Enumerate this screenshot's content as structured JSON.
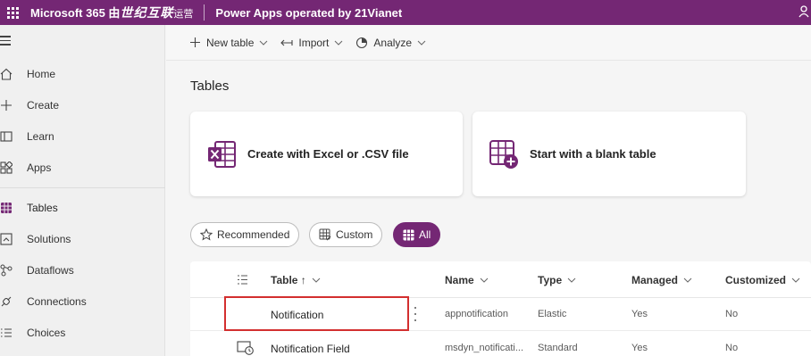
{
  "topbar": {
    "brand_prefix": "Microsoft 365 由",
    "brand_cn": "世纪互联",
    "brand_suffix": "运营",
    "app_name": "Power Apps operated by 21Vianet"
  },
  "sidebar": {
    "items": [
      {
        "label": "Home",
        "icon": "home-icon"
      },
      {
        "label": "Create",
        "icon": "plus-icon"
      },
      {
        "label": "Learn",
        "icon": "book-icon"
      },
      {
        "label": "Apps",
        "icon": "apps-icon"
      },
      {
        "label": "Tables",
        "icon": "table-icon"
      },
      {
        "label": "Solutions",
        "icon": "solutions-icon"
      },
      {
        "label": "Dataflows",
        "icon": "dataflows-icon"
      },
      {
        "label": "Connections",
        "icon": "connections-icon"
      },
      {
        "label": "Choices",
        "icon": "choices-icon"
      }
    ],
    "active": "Tables"
  },
  "commandbar": {
    "new_table": "New table",
    "import": "Import",
    "analyze": "Analyze"
  },
  "main": {
    "title": "Tables",
    "cards": [
      {
        "label": "Create with Excel or .CSV file",
        "icon": "excel-icon"
      },
      {
        "label": "Start with a blank table",
        "icon": "blank-table-icon"
      }
    ],
    "filters": [
      {
        "label": "Recommended",
        "icon": "star-icon",
        "active": false
      },
      {
        "label": "Custom",
        "icon": "custom-table-icon",
        "active": false
      },
      {
        "label": "All",
        "icon": "grid-icon",
        "active": true
      }
    ]
  },
  "table": {
    "columns": [
      "Table ↑",
      "Name",
      "Type",
      "Managed",
      "Customized"
    ],
    "rows": [
      {
        "table": "Notification",
        "name": "appnotification",
        "type": "Elastic",
        "managed": "Yes",
        "customized": "No"
      },
      {
        "table": "Notification Field",
        "name": "msdyn_notificati...",
        "type": "Standard",
        "managed": "Yes",
        "customized": "No"
      }
    ]
  },
  "colors": {
    "brand_purple": "#742774",
    "highlight_red": "#d32f2f"
  }
}
